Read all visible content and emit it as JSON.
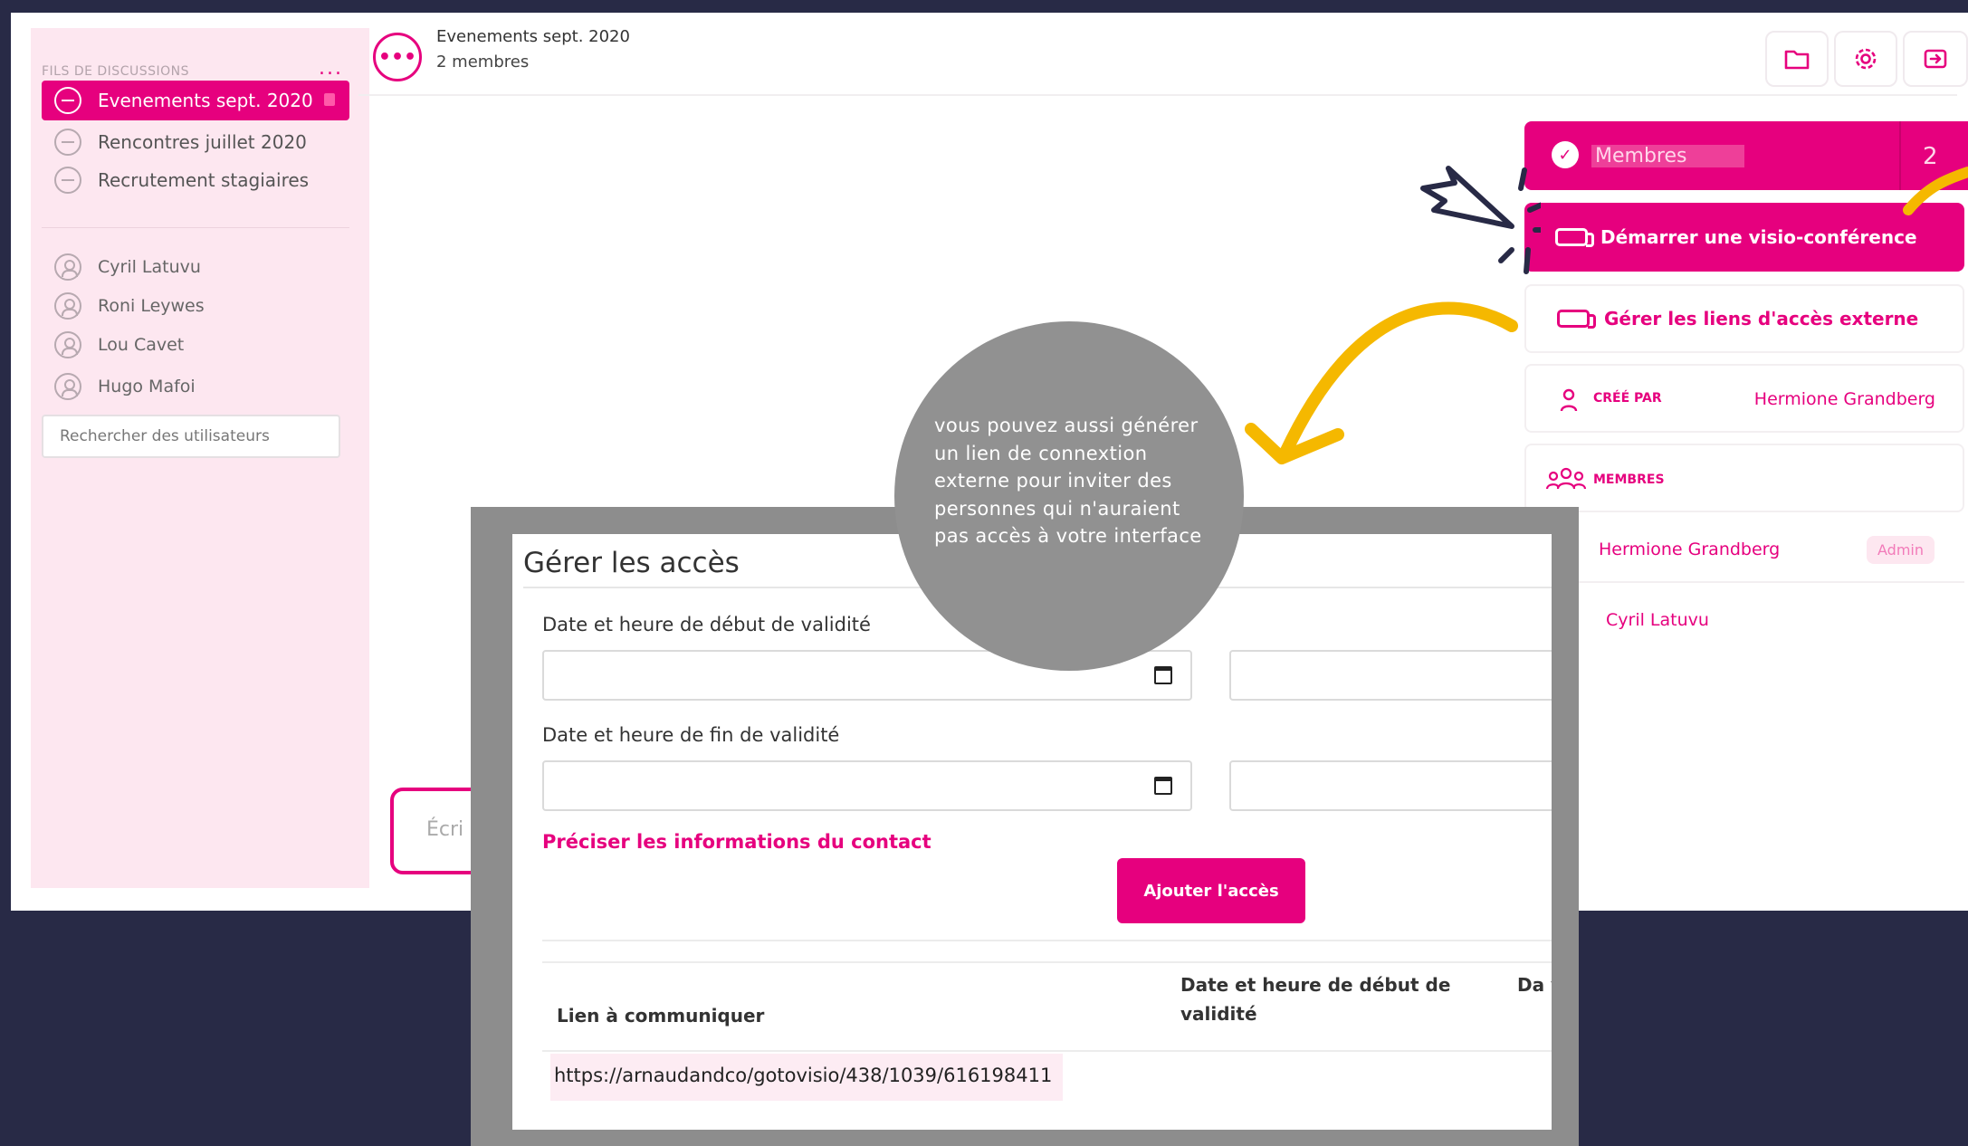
{
  "sidebar": {
    "title": "FILS DE DISCUSSIONS",
    "more": "...",
    "threads": [
      {
        "label": "Evenements sept. 2020",
        "active": true
      },
      {
        "label": "Rencontres juillet 2020",
        "active": false
      },
      {
        "label": "Recrutement stagiaires",
        "active": false
      }
    ],
    "users": [
      {
        "label": "Cyril Latuvu"
      },
      {
        "label": "Roni Leywes"
      },
      {
        "label": "Lou Cavet"
      },
      {
        "label": "Hugo Mafoi"
      }
    ],
    "search_placeholder": "Rechercher des utilisateurs"
  },
  "header": {
    "icon": "•••",
    "title": "Evenements sept. 2020",
    "subtitle": "2 membres",
    "buttons": [
      "folder-icon",
      "gear-icon",
      "exit-icon"
    ]
  },
  "right_panel": {
    "members_label": "Membres",
    "members_count": "2",
    "visio_label": "Démarrer une visio-conférence",
    "links_label": "Gérer les liens d'accès externe",
    "created_by_key": "CRÉÉ PAR",
    "created_by_value": "Hermione Grandberg",
    "members_key": "MEMBRES",
    "members": [
      {
        "name": "Hermione Grandberg",
        "badge": "Admin"
      },
      {
        "name": "Cyril Latuvu",
        "badge": ""
      }
    ]
  },
  "composer": {
    "placeholder": "Écri"
  },
  "tooltip": {
    "text": "vous pouvez aussi générer un lien de connextion externe pour inviter des personnes qui n'auraient pas accès à votre interface"
  },
  "modal": {
    "title": "Gérer les accès",
    "start_label": "Date et heure de début de validité",
    "end_label": "Date et heure de fin de validité",
    "contact_link": "Préciser les informations du contact",
    "add_button": "Ajouter l'accès",
    "columns": {
      "link": "Lien à communiquer",
      "start": "Date et heure de début de validité",
      "end": "Da val"
    },
    "row_link": "https://arnaudandco/gotovisio/438/1039/616198411"
  },
  "colors": {
    "accent": "#e6007e",
    "background": "#282a46",
    "sidebar": "#fde7f0",
    "annotation_arrow": "#f5b800",
    "tooltip": "#919191"
  }
}
